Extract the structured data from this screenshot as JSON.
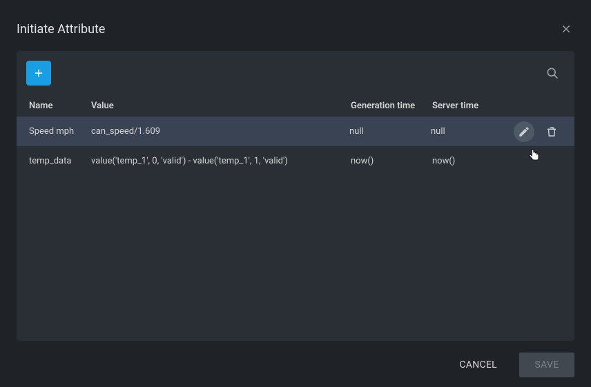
{
  "dialog": {
    "title": "Initiate Attribute"
  },
  "table": {
    "headers": {
      "name": "Name",
      "value": "Value",
      "generation_time": "Generation time",
      "server_time": "Server time"
    },
    "rows": [
      {
        "name": "Speed mph",
        "value": "can_speed/1.609",
        "generation_time": "null",
        "server_time": "null"
      },
      {
        "name": "temp_data",
        "value": "value('temp_1', 0, 'valid') - value('temp_1', 1, 'valid')",
        "generation_time": "now()",
        "server_time": "now()"
      }
    ]
  },
  "footer": {
    "cancel": "CANCEL",
    "save": "SAVE"
  }
}
